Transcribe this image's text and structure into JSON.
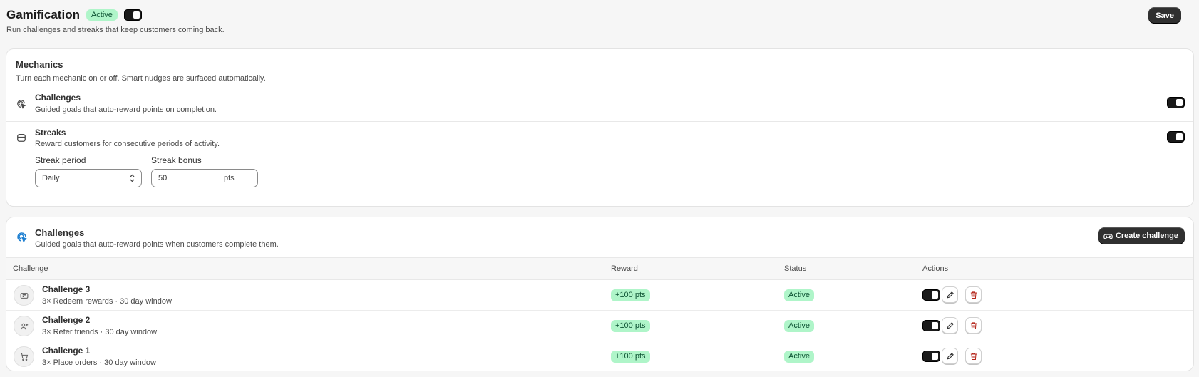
{
  "header": {
    "title": "Gamification",
    "status_badge": "Active",
    "subtitle": "Run challenges and streaks that keep customers coming back.",
    "save_label": "Save"
  },
  "mechanics": {
    "title": "Mechanics",
    "subtitle": "Turn each mechanic on or off. Smart nudges are surfaced automatically.",
    "challenges": {
      "name": "Challenges",
      "description": "Guided goals that auto-reward points on completion.",
      "icon": "target-cursor-icon",
      "enabled": true
    },
    "streaks": {
      "name": "Streaks",
      "description": "Reward customers for consecutive periods of activity.",
      "icon": "calendar-icon",
      "enabled": true,
      "period_label": "Streak period",
      "period_value": "Daily",
      "bonus_label": "Streak bonus",
      "bonus_value": "50",
      "bonus_suffix": "pts"
    }
  },
  "challenges": {
    "title": "Challenges",
    "subtitle": "Guided goals that auto-reward points when customers complete them.",
    "create_label": "Create challenge",
    "columns": [
      "Challenge",
      "Reward",
      "Status",
      "Actions"
    ],
    "rows": [
      {
        "name": "Challenge 3",
        "description": "3× Redeem rewards · 30 day window",
        "icon": "ticket-icon",
        "reward": "+100 pts",
        "status": "Active",
        "enabled": true
      },
      {
        "name": "Challenge 2",
        "description": "3× Refer friends · 30 day window",
        "icon": "user-plus-icon",
        "reward": "+100 pts",
        "status": "Active",
        "enabled": true
      },
      {
        "name": "Challenge 1",
        "description": "3× Place orders · 30 day window",
        "icon": "cart-icon",
        "reward": "+100 pts",
        "status": "Active",
        "enabled": true
      }
    ]
  },
  "colors": {
    "accent": "#303030",
    "success_bg": "#aff5c9",
    "success_text": "#0c5132",
    "danger": "#b42318",
    "info": "#1d7fd1"
  }
}
